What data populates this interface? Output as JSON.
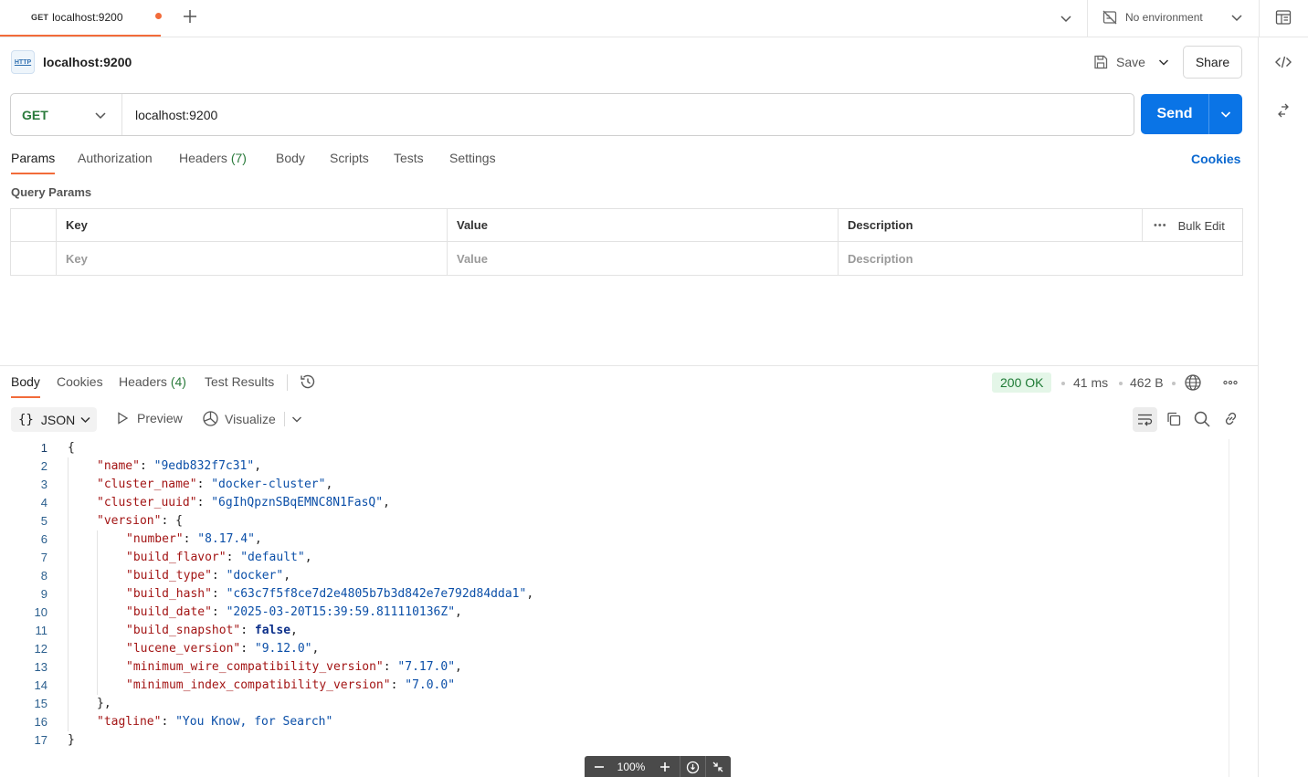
{
  "tab": {
    "method": "GET",
    "title": "localhost:9200"
  },
  "environment": {
    "label": "No environment"
  },
  "request": {
    "name": "localhost:9200",
    "http_badge": "HTTP",
    "method": "GET",
    "url": "localhost:9200",
    "save_label": "Save",
    "share_label": "Share",
    "send_label": "Send"
  },
  "request_tabs": {
    "params": "Params",
    "authorization": "Authorization",
    "headers": "Headers",
    "headers_count": "(7)",
    "body": "Body",
    "scripts": "Scripts",
    "tests": "Tests",
    "settings": "Settings",
    "cookies": "Cookies"
  },
  "query_params": {
    "title": "Query Params",
    "columns": {
      "key": "Key",
      "value": "Value",
      "description": "Description"
    },
    "bulk_edit": "Bulk Edit",
    "placeholders": {
      "key": "Key",
      "value": "Value",
      "description": "Description"
    }
  },
  "response_tabs": {
    "body": "Body",
    "cookies": "Cookies",
    "headers": "Headers",
    "headers_count": "(4)",
    "test_results": "Test Results"
  },
  "response_meta": {
    "status": "200 OK",
    "time": "41 ms",
    "size": "462 B"
  },
  "response_toolbar": {
    "format": "JSON",
    "format_braces": "{}",
    "preview": "Preview",
    "visualize": "Visualize"
  },
  "zoom": {
    "level": "100%"
  },
  "colors": {
    "accent": "#f26b3a",
    "send": "#0a74e6",
    "status_ok": "#1e7a35",
    "method_get": "#2a7a3b"
  },
  "code_lines": [
    {
      "n": "1",
      "indent": 0,
      "parts": [
        {
          "t": "p",
          "v": "{"
        }
      ]
    },
    {
      "n": "2",
      "indent": 1,
      "parts": [
        {
          "t": "k",
          "v": "\"name\""
        },
        {
          "t": "p",
          "v": ": "
        },
        {
          "t": "s",
          "v": "\"9edb832f7c31\""
        },
        {
          "t": "p",
          "v": ","
        }
      ]
    },
    {
      "n": "3",
      "indent": 1,
      "parts": [
        {
          "t": "k",
          "v": "\"cluster_name\""
        },
        {
          "t": "p",
          "v": ": "
        },
        {
          "t": "s",
          "v": "\"docker-cluster\""
        },
        {
          "t": "p",
          "v": ","
        }
      ]
    },
    {
      "n": "4",
      "indent": 1,
      "parts": [
        {
          "t": "k",
          "v": "\"cluster_uuid\""
        },
        {
          "t": "p",
          "v": ": "
        },
        {
          "t": "s",
          "v": "\"6gIhQpznSBqEMNC8N1FasQ\""
        },
        {
          "t": "p",
          "v": ","
        }
      ]
    },
    {
      "n": "5",
      "indent": 1,
      "parts": [
        {
          "t": "k",
          "v": "\"version\""
        },
        {
          "t": "p",
          "v": ": {"
        }
      ]
    },
    {
      "n": "6",
      "indent": 2,
      "parts": [
        {
          "t": "k",
          "v": "\"number\""
        },
        {
          "t": "p",
          "v": ": "
        },
        {
          "t": "s",
          "v": "\"8.17.4\""
        },
        {
          "t": "p",
          "v": ","
        }
      ]
    },
    {
      "n": "7",
      "indent": 2,
      "parts": [
        {
          "t": "k",
          "v": "\"build_flavor\""
        },
        {
          "t": "p",
          "v": ": "
        },
        {
          "t": "s",
          "v": "\"default\""
        },
        {
          "t": "p",
          "v": ","
        }
      ]
    },
    {
      "n": "8",
      "indent": 2,
      "parts": [
        {
          "t": "k",
          "v": "\"build_type\""
        },
        {
          "t": "p",
          "v": ": "
        },
        {
          "t": "s",
          "v": "\"docker\""
        },
        {
          "t": "p",
          "v": ","
        }
      ]
    },
    {
      "n": "9",
      "indent": 2,
      "parts": [
        {
          "t": "k",
          "v": "\"build_hash\""
        },
        {
          "t": "p",
          "v": ": "
        },
        {
          "t": "s",
          "v": "\"c63c7f5f8ce7d2e4805b7b3d842e7e792d84dda1\""
        },
        {
          "t": "p",
          "v": ","
        }
      ]
    },
    {
      "n": "10",
      "indent": 2,
      "parts": [
        {
          "t": "k",
          "v": "\"build_date\""
        },
        {
          "t": "p",
          "v": ": "
        },
        {
          "t": "s",
          "v": "\"2025-03-20T15:39:59.811110136Z\""
        },
        {
          "t": "p",
          "v": ","
        }
      ]
    },
    {
      "n": "11",
      "indent": 2,
      "parts": [
        {
          "t": "k",
          "v": "\"build_snapshot\""
        },
        {
          "t": "p",
          "v": ": "
        },
        {
          "t": "b",
          "v": "false"
        },
        {
          "t": "p",
          "v": ","
        }
      ]
    },
    {
      "n": "12",
      "indent": 2,
      "parts": [
        {
          "t": "k",
          "v": "\"lucene_version\""
        },
        {
          "t": "p",
          "v": ": "
        },
        {
          "t": "s",
          "v": "\"9.12.0\""
        },
        {
          "t": "p",
          "v": ","
        }
      ]
    },
    {
      "n": "13",
      "indent": 2,
      "parts": [
        {
          "t": "k",
          "v": "\"minimum_wire_compatibility_version\""
        },
        {
          "t": "p",
          "v": ": "
        },
        {
          "t": "s",
          "v": "\"7.17.0\""
        },
        {
          "t": "p",
          "v": ","
        }
      ]
    },
    {
      "n": "14",
      "indent": 2,
      "parts": [
        {
          "t": "k",
          "v": "\"minimum_index_compatibility_version\""
        },
        {
          "t": "p",
          "v": ": "
        },
        {
          "t": "s",
          "v": "\"7.0.0\""
        }
      ]
    },
    {
      "n": "15",
      "indent": 1,
      "parts": [
        {
          "t": "p",
          "v": "},"
        }
      ]
    },
    {
      "n": "16",
      "indent": 1,
      "parts": [
        {
          "t": "k",
          "v": "\"tagline\""
        },
        {
          "t": "p",
          "v": ": "
        },
        {
          "t": "s",
          "v": "\"You Know, for Search\""
        }
      ]
    },
    {
      "n": "17",
      "indent": 0,
      "parts": [
        {
          "t": "p",
          "v": "}"
        }
      ]
    }
  ]
}
